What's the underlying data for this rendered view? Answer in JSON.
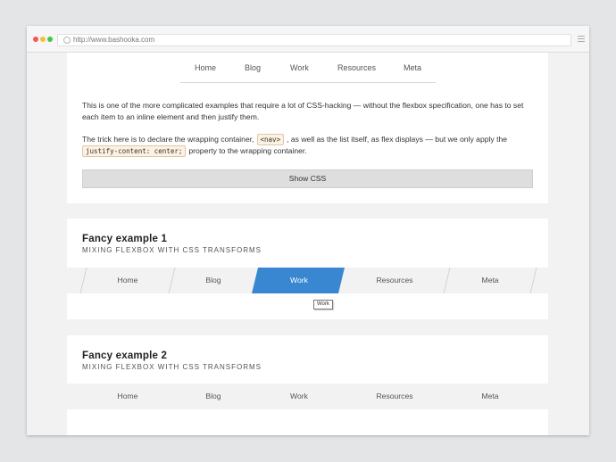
{
  "browser": {
    "url": "http://www.bashooka.com"
  },
  "intro": {
    "nav": [
      "Home",
      "Blog",
      "Work",
      "Resources",
      "Meta"
    ],
    "paragraph1": "This is one of the more complicated examples that require a lot of CSS-hacking — without the flexbox specification, one has to set each item to an inline element and then justify them.",
    "paragraph2_before": "The trick here is to declare the wrapping container,",
    "paragraph2_code1": "<nav>",
    "paragraph2_middle": ", as well as the list itself, as flex displays — but we only apply the",
    "paragraph2_code2": "justify-content: center;",
    "paragraph2_after": "property to the wrapping container.",
    "show_css_label": "Show CSS"
  },
  "fancy1": {
    "title": "Fancy example 1",
    "subtitle": "MIXING FLEXBOX WITH CSS TRANSFORMS",
    "nav": [
      "Home",
      "Blog",
      "Work",
      "Resources",
      "Meta"
    ],
    "active_index": 2,
    "tooltip": "Work",
    "active_color": "#3a87d1"
  },
  "fancy2": {
    "title": "Fancy example 2",
    "subtitle": "MIXING FLEXBOX WITH CSS TRANSFORMS",
    "nav": [
      "Home",
      "Blog",
      "Work",
      "Resources",
      "Meta"
    ]
  }
}
